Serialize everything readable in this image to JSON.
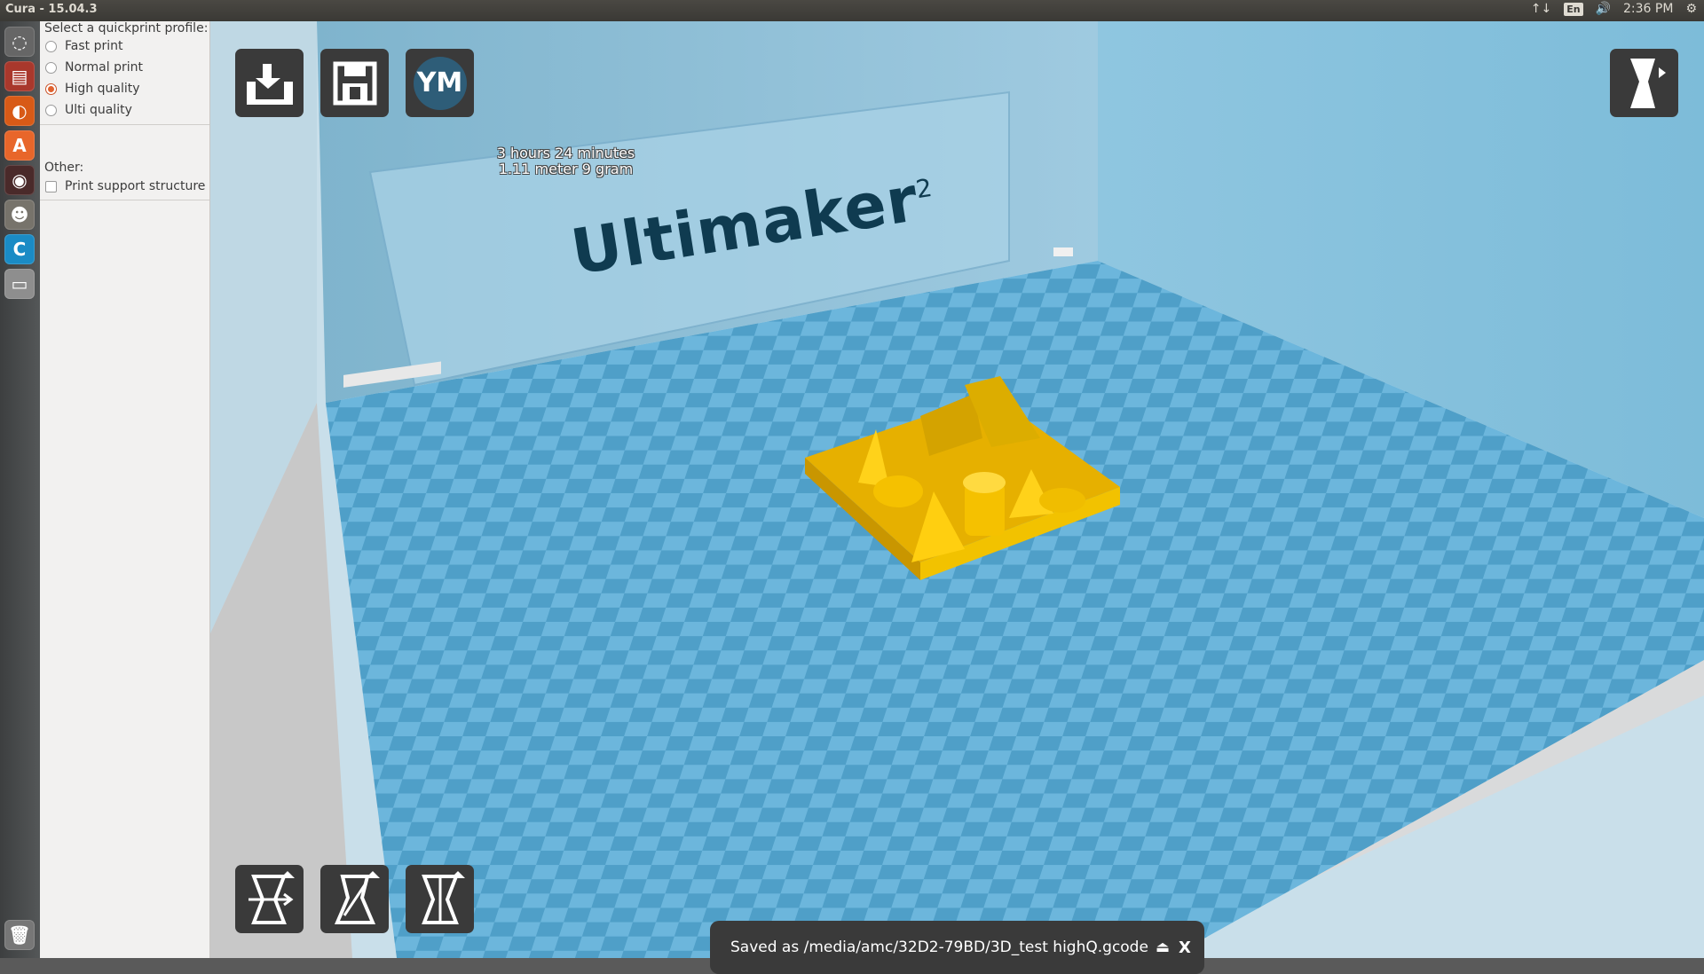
{
  "window": {
    "title": "Cura - 15.04.3"
  },
  "tray": {
    "network_icon": "↑↓",
    "language": "En",
    "volume_icon": "🔊",
    "time": "2:36 PM",
    "gear_icon": "⚙"
  },
  "launcher": {
    "items": [
      "dash-icon",
      "files-icon",
      "firefox-icon",
      "software-center-icon",
      "unity-app-icon",
      "gimp-icon",
      "cura-icon",
      "drive-icon",
      "trash-icon"
    ]
  },
  "panel": {
    "profile_header": "Select a quickprint profile:",
    "profiles": [
      {
        "label": "Fast print",
        "selected": false
      },
      {
        "label": "Normal print",
        "selected": false
      },
      {
        "label": "High quality",
        "selected": true
      },
      {
        "label": "Ulti quality",
        "selected": false
      }
    ],
    "other_header": "Other:",
    "support_label": "Print support structure",
    "support_checked": false
  },
  "viewport": {
    "ym_label": "YM",
    "print_time": "3 hours 24 minutes",
    "print_material": "1.11 meter 9 gram",
    "brand_text": "Ultimaker",
    "brand_sup": "2"
  },
  "toast": {
    "message": "Saved as /media/amc/32D2-79BD/3D_test highQ.gcode",
    "close_label": "X"
  },
  "colors": {
    "bed": "#6fb9de",
    "model": "#f5c100",
    "accent": "#e0622f"
  }
}
